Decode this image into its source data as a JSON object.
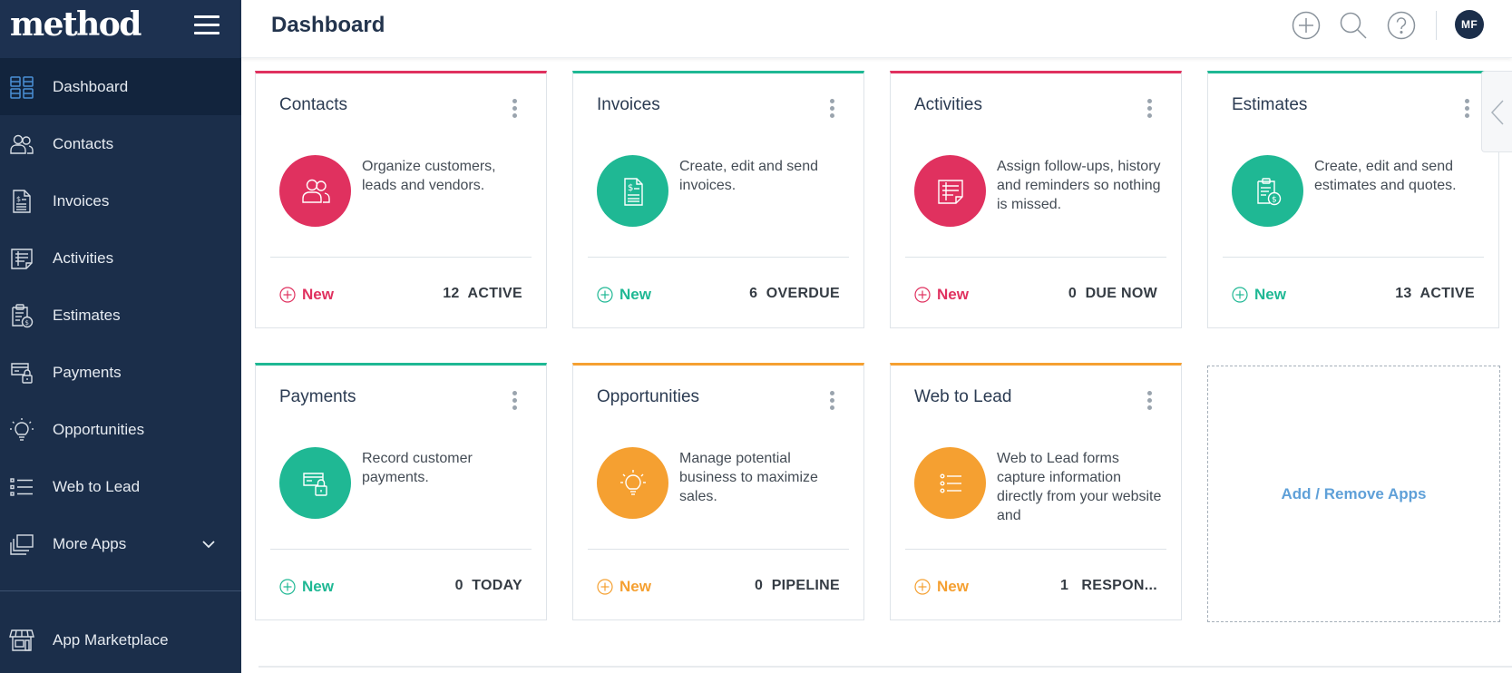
{
  "app": {
    "logo": "method"
  },
  "header": {
    "title": "Dashboard",
    "avatar_initials": "MF"
  },
  "colors": {
    "pink": "#e0315f",
    "teal": "#1fb894",
    "orange": "#f5a031",
    "sidebar": "#1b2e4a",
    "link": "#5fa0d8"
  },
  "sidebar": {
    "items": [
      {
        "label": "Dashboard",
        "icon": "dashboard-icon",
        "active": true
      },
      {
        "label": "Contacts",
        "icon": "contacts-icon"
      },
      {
        "label": "Invoices",
        "icon": "invoice-icon"
      },
      {
        "label": "Activities",
        "icon": "activities-icon"
      },
      {
        "label": "Estimates",
        "icon": "estimates-icon"
      },
      {
        "label": "Payments",
        "icon": "payments-icon"
      },
      {
        "label": "Opportunities",
        "icon": "lightbulb-icon"
      },
      {
        "label": "Web to Lead",
        "icon": "list-icon"
      },
      {
        "label": "More Apps",
        "icon": "stack-icon"
      }
    ],
    "marketplace": {
      "label": "App Marketplace",
      "icon": "storefront-icon"
    }
  },
  "cards": [
    {
      "title": "Contacts",
      "description": "Organize customers, leads and vendors.",
      "new_label": "New",
      "stat": "12  ACTIVE",
      "color": "pink",
      "icon": "contacts-icon"
    },
    {
      "title": "Invoices",
      "description": "Create, edit and send invoices.",
      "new_label": "New",
      "stat": "6  OVERDUE",
      "color": "teal",
      "icon": "invoice-icon"
    },
    {
      "title": "Activities",
      "description": "Assign follow-ups, history and reminders so nothing is missed.",
      "new_label": "New",
      "stat": "0  DUE NOW",
      "color": "pink",
      "icon": "activities-icon"
    },
    {
      "title": "Estimates",
      "description": "Create, edit and send estimates and quotes.",
      "new_label": "New",
      "stat": "13  ACTIVE",
      "color": "teal",
      "icon": "estimates-icon"
    },
    {
      "title": "Payments",
      "description": "Record customer payments.",
      "new_label": "New",
      "stat": "0  TODAY",
      "color": "teal",
      "icon": "payments-icon"
    },
    {
      "title": "Opportunities",
      "description": "Manage potential business to maximize sales.",
      "new_label": "New",
      "stat": "0  PIPELINE",
      "color": "orange",
      "icon": "lightbulb-icon"
    },
    {
      "title": "Web to Lead",
      "description": "Web to Lead forms capture information directly from your website and",
      "new_label": "New",
      "stat": "1   RESPON...",
      "color": "orange",
      "icon": "list-icon"
    }
  ],
  "add_apps": {
    "label": "Add / Remove Apps"
  }
}
